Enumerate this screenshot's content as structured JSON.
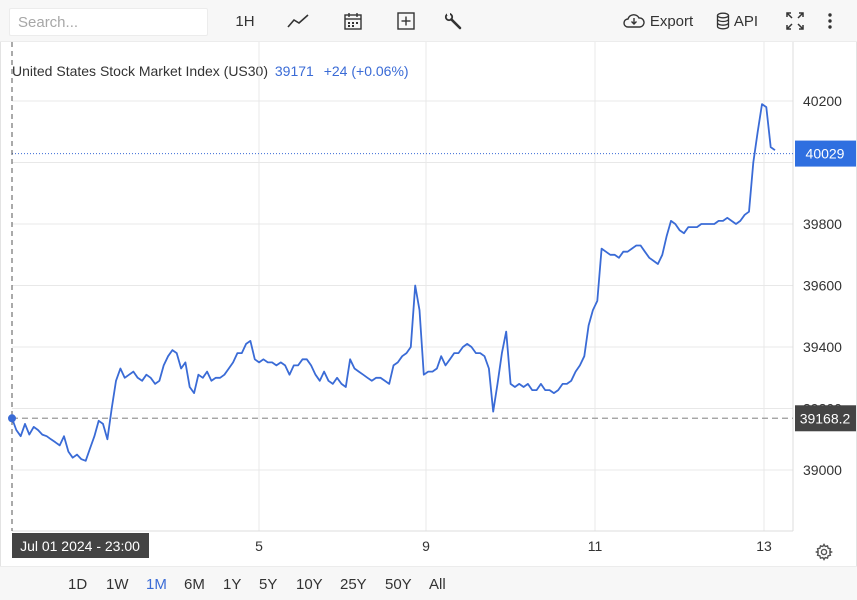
{
  "toolbar": {
    "search_placeholder": "Search...",
    "interval_label": "1H",
    "export_label": "Export",
    "api_label": "API"
  },
  "header": {
    "instrument_name": "United States Stock Market Index (US30)",
    "price": "39171",
    "change": "+24 (+0.06%)"
  },
  "colors": {
    "line": "#3a6bd6",
    "badge": "#2f6fe0",
    "crosshair_badge": "#444444",
    "grid": "#e8e8e8"
  },
  "range_buttons": [
    "1D",
    "1W",
    "1M",
    "6M",
    "1Y",
    "5Y",
    "10Y",
    "25Y",
    "50Y",
    "All"
  ],
  "active_range": "1M",
  "crosshair": {
    "date_label": "Jul 01 2024 - 23:00",
    "value_label": "39168.2",
    "value": 39168.2
  },
  "last_price": {
    "label": "40029",
    "value": 40029
  },
  "chart_data": {
    "type": "line",
    "title": "United States Stock Market Index (US30)",
    "xlabel": "",
    "ylabel": "",
    "x_ticks": [
      "5",
      "9",
      "11",
      "13"
    ],
    "y_ticks": [
      39000,
      39200,
      39400,
      39600,
      39800,
      40200
    ],
    "ylim": [
      38800,
      40350
    ],
    "grid": true,
    "series": [
      {
        "values": [
          39168,
          39130,
          39110,
          39150,
          39115,
          39140,
          39130,
          39115,
          39110,
          39100,
          39090,
          39080,
          39110,
          39060,
          39040,
          39050,
          39035,
          39030,
          39070,
          39110,
          39160,
          39150,
          39100,
          39200,
          39290,
          39330,
          39300,
          39310,
          39320,
          39300,
          39290,
          39310,
          39300,
          39280,
          39290,
          39340,
          39370,
          39390,
          39380,
          39330,
          39350,
          39270,
          39250,
          39310,
          39300,
          39320,
          39290,
          39300,
          39300,
          39310,
          39330,
          39350,
          39380,
          39380,
          39410,
          39420,
          39360,
          39350,
          39360,
          39350,
          39350,
          39340,
          39350,
          39340,
          39310,
          39340,
          39340,
          39360,
          39360,
          39340,
          39310,
          39290,
          39320,
          39290,
          39280,
          39300,
          39280,
          39270,
          39360,
          39330,
          39320,
          39310,
          39300,
          39290,
          39300,
          39300,
          39290,
          39280,
          39340,
          39350,
          39370,
          39380,
          39400,
          39600,
          39520,
          39310,
          39320,
          39320,
          39330,
          39370,
          39340,
          39360,
          39380,
          39380,
          39400,
          39410,
          39400,
          39380,
          39380,
          39370,
          39330,
          39190,
          39280,
          39380,
          39450,
          39280,
          39270,
          39280,
          39270,
          39280,
          39260,
          39260,
          39280,
          39260,
          39260,
          39250,
          39260,
          39280,
          39280,
          39290,
          39320,
          39340,
          39370,
          39470,
          39520,
          39550,
          39720,
          39710,
          39700,
          39700,
          39690,
          39710,
          39710,
          39720,
          39730,
          39730,
          39710,
          39690,
          39680,
          39670,
          39700,
          39760,
          39810,
          39800,
          39780,
          39770,
          39790,
          39790,
          39790,
          39800,
          39800,
          39800,
          39800,
          39810,
          39810,
          39820,
          39810,
          39800,
          39810,
          39830,
          39840,
          40000,
          40100,
          40190,
          40180,
          40050,
          40040
        ]
      }
    ]
  }
}
